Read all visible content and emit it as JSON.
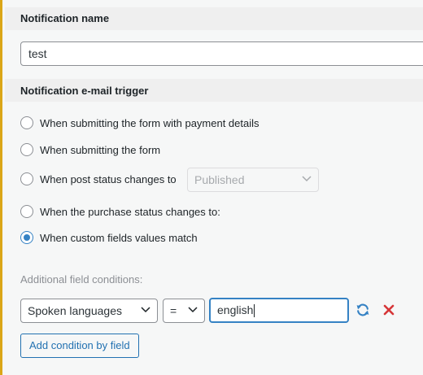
{
  "notification_name": {
    "label": "Notification name",
    "value": "test"
  },
  "trigger": {
    "label": "Notification e-mail trigger",
    "options": [
      {
        "label": "When submitting the form with payment details",
        "checked": false
      },
      {
        "label": "When submitting the form",
        "checked": false
      },
      {
        "label": "When post status changes to",
        "checked": false
      },
      {
        "label": "When the purchase status changes to:",
        "checked": false
      },
      {
        "label": "When custom fields values match",
        "checked": true
      }
    ],
    "post_status_select": {
      "value": "Published",
      "disabled": true
    }
  },
  "conditions": {
    "label": "Additional field conditions:",
    "field_select": "Spoken languages",
    "operator_select": "=",
    "value_input": "english",
    "refresh_icon": "refresh-icon",
    "remove_icon": "close-icon",
    "add_button": "Add condition by field"
  },
  "colors": {
    "accent": "#3582c4",
    "danger": "#d63638",
    "border_highlight": "#dba617"
  }
}
